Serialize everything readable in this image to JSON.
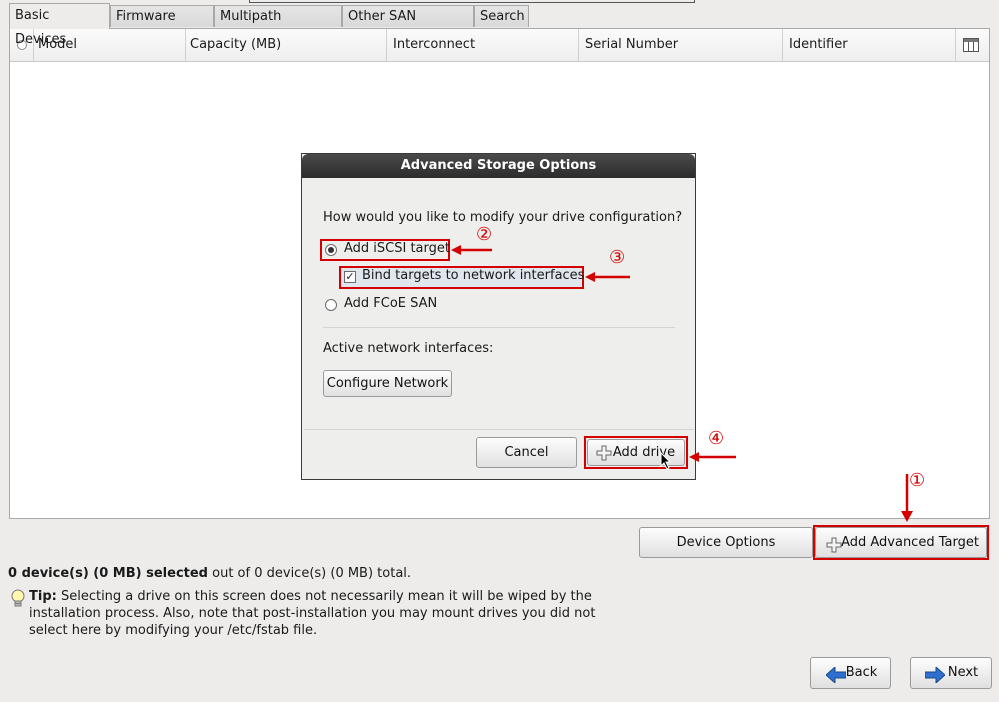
{
  "tabs": [
    "Basic Devices",
    "Firmware RAID",
    "Multipath Devices",
    "Other SAN Devices",
    "Search"
  ],
  "table": {
    "columns": [
      "Model",
      "Capacity (MB)",
      "Interconnect",
      "Serial Number",
      "Identifier"
    ]
  },
  "dialog": {
    "title": "Advanced Storage Options",
    "question": "How would you like to modify your drive configuration?",
    "option_iscsi": "Add iSCSI target",
    "option_bind": "Bind targets to network interfaces",
    "option_fcoe": "Add FCoE SAN",
    "active_interfaces_label": "Active network interfaces:",
    "configure_network": "Configure Network",
    "cancel": "Cancel",
    "add_drive": "Add drive"
  },
  "device_options": "Device Options",
  "add_advanced_target": "Add Advanced Target",
  "summary_bold": "0 device(s) (0 MB) selected",
  "summary_rest": " out of 0 device(s) (0 MB) total.",
  "tip_label": "Tip:",
  "tip_line1": " Selecting a drive on this screen does not necessarily mean it will be wiped by the",
  "tip_line2": "installation process.  Also, note that post-installation you may mount drives you did not",
  "tip_line3": "select here by modifying your /etc/fstab file.",
  "back": "Back",
  "next": "Next",
  "annotations": [
    "①",
    "②",
    "③",
    "④"
  ],
  "colors": {
    "annotation_red": "#d40000",
    "title_bar": "#2c2c2c"
  }
}
